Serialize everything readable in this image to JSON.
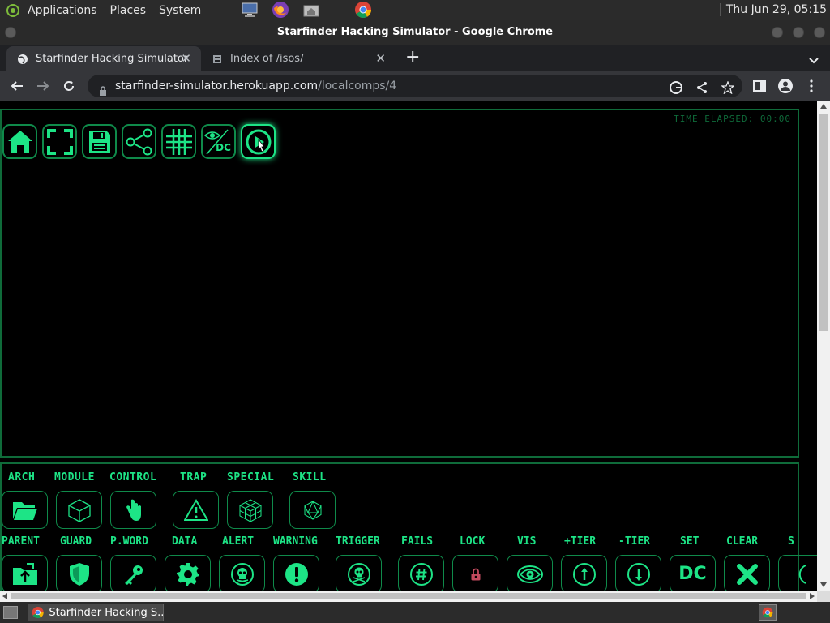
{
  "top_panel": {
    "menus": [
      "Applications",
      "Places",
      "System"
    ],
    "clock": "Thu Jun 29, 05:15"
  },
  "window": {
    "title": "Starfinder Hacking Simulator - Google Chrome"
  },
  "tabs": [
    {
      "label": "Starfinder Hacking Simulator",
      "active": true
    },
    {
      "label": "Index of /isos/",
      "active": false
    }
  ],
  "address": {
    "host": "starfinder-simulator.herokuapp.com",
    "path": "/localcomps/4"
  },
  "app": {
    "timer": "TIME ELAPSED: 00:00",
    "toolbar_icons": [
      "home-icon",
      "fullscreen-icon",
      "save-icon",
      "share-icon",
      "grid-icon",
      "visibility-dc-icon",
      "play-icon"
    ],
    "visibility_dc_text": "DC",
    "categories": [
      {
        "label": "ARCH",
        "icon": "folder-icon"
      },
      {
        "label": "MODULE",
        "icon": "cube-icon"
      },
      {
        "label": "CONTROL",
        "icon": "hand-icon"
      },
      {
        "label": "TRAP",
        "icon": "warning-triangle-icon"
      },
      {
        "label": "SPECIAL",
        "icon": "grid-cube-icon"
      },
      {
        "label": "SKILL",
        "icon": "d20-icon"
      }
    ],
    "nodes": [
      {
        "label": "PARENT",
        "icon": "folder-upload-icon"
      },
      {
        "label": "GUARD",
        "icon": "shield-icon"
      },
      {
        "label": "P.WORD",
        "icon": "key-icon"
      },
      {
        "label": "DATA",
        "icon": "gear-icon"
      },
      {
        "label": "ALERT",
        "icon": "skull-icon"
      },
      {
        "label": "WARNING",
        "icon": "exclamation-icon"
      },
      {
        "label": "TRIGGER",
        "icon": "skull-crossbones-icon"
      },
      {
        "label": "FAILS",
        "icon": "hash-icon"
      },
      {
        "label": "LOCK",
        "icon": "lock-icon"
      },
      {
        "label": "VIS",
        "icon": "eye-icon"
      },
      {
        "label": "+TIER",
        "icon": "arrow-up-icon"
      },
      {
        "label": "-TIER",
        "icon": "arrow-down-icon"
      },
      {
        "label": "SET",
        "icon": "dc-icon",
        "text": "DC"
      },
      {
        "label": "CLEAR",
        "icon": "x-icon"
      },
      {
        "label": "S",
        "icon": "partial-icon"
      }
    ]
  },
  "taskbar": {
    "item": "Starfinder Hacking S..."
  },
  "colors": {
    "accent": "#1de486",
    "border": "#0f6b3a",
    "background": "#000000"
  }
}
